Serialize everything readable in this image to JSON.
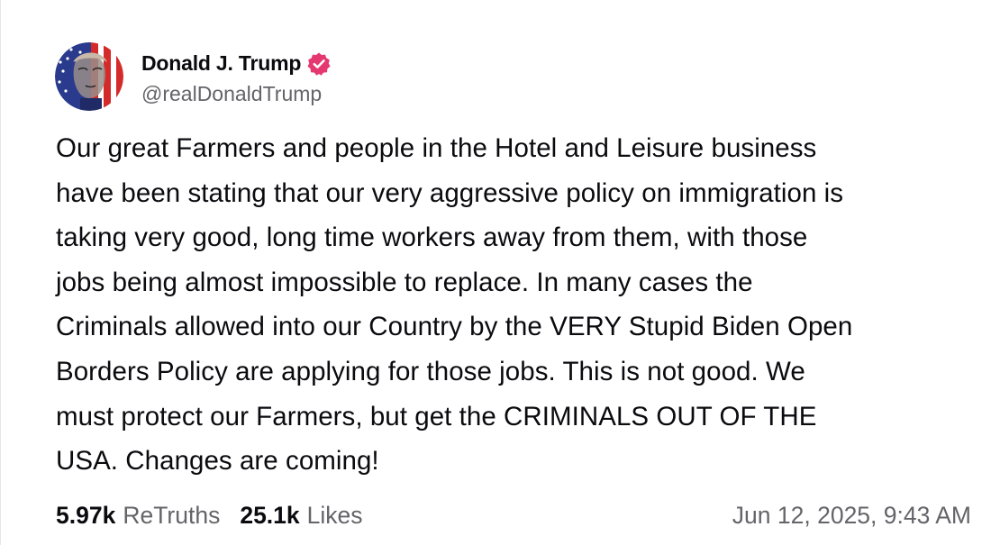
{
  "post": {
    "author": {
      "display_name": "Donald J. Trump",
      "handle": "@realDonaldTrump",
      "verified_icon": "verified-badge-icon",
      "verified_color": "#e53870"
    },
    "text": "Our great Farmers and people in the Hotel and Leisure business\nhave been stating that our very aggressive policy on immigration is\ntaking very good, long time workers away from them, with those\njobs being almost impossible to replace. In many cases the\nCriminals allowed into our Country by the VERY Stupid Biden Open\nBorders Policy are applying for those jobs. This is not good. We\nmust protect our Farmers, but get the CRIMINALS OUT OF THE\nUSA. Changes are coming!",
    "stats": {
      "retruths_count": "5.97k",
      "retruths_label": "ReTruths",
      "likes_count": "25.1k",
      "likes_label": "Likes"
    },
    "timestamp": "Jun 12, 2025, 9:43 AM"
  },
  "colors": {
    "text_primary": "#0b0b0f",
    "text_secondary": "#646469",
    "accent": "#e53870"
  }
}
